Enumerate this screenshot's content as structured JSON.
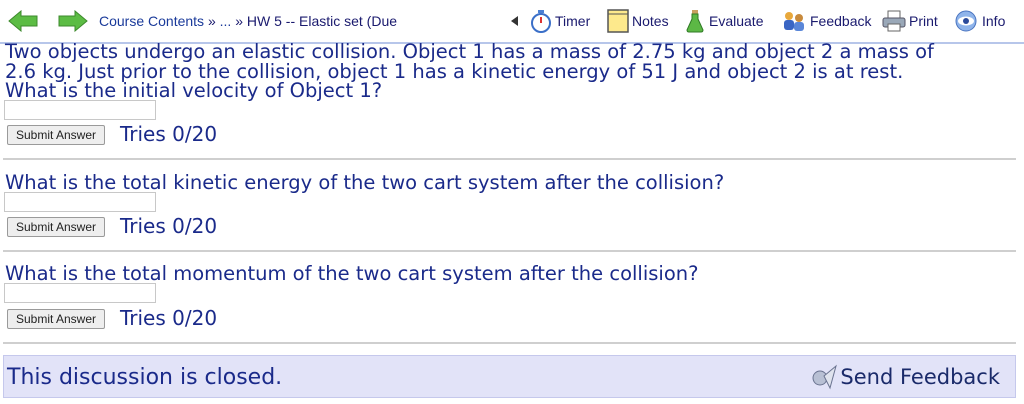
{
  "nav": {
    "breadcrumb": {
      "course_contents": "Course Contents",
      "sep1": "»",
      "ellipsis": "...",
      "sep2": "»",
      "current": "HW 5 -- Elastic set (Due"
    },
    "tools": {
      "timer": "Timer",
      "notes": "Notes",
      "evaluate": "Evaluate",
      "feedback": "Feedback",
      "print": "Print",
      "info": "Info"
    }
  },
  "problem": {
    "line1": "Two objects undergo an elastic collision. Object 1 has a mass of 2.75 kg and object 2 a mass of",
    "line2": "2.6 kg. Just prior to the collision, object 1 has a kinetic energy of 51 J and object 2 is at rest.",
    "questions": [
      {
        "text": "What is the initial velocity of Object 1?",
        "answer_value": "",
        "submit_label": "Submit Answer",
        "tries": "Tries 0/20"
      },
      {
        "text": "What is the total kinetic energy of the two cart system after the collision?",
        "answer_value": "",
        "submit_label": "Submit Answer",
        "tries": "Tries 0/20"
      },
      {
        "text": "What is the total momentum of the two cart system after the collision?",
        "answer_value": "",
        "submit_label": "Submit Answer",
        "tries": "Tries 0/20"
      }
    ]
  },
  "discussion": {
    "status": "This discussion is closed.",
    "send_feedback": "Send Feedback"
  },
  "colors": {
    "nav_arrow_green": "#4caf3c",
    "text_blue": "#1a2a8a",
    "discussion_bg": "#e2e3f8"
  }
}
